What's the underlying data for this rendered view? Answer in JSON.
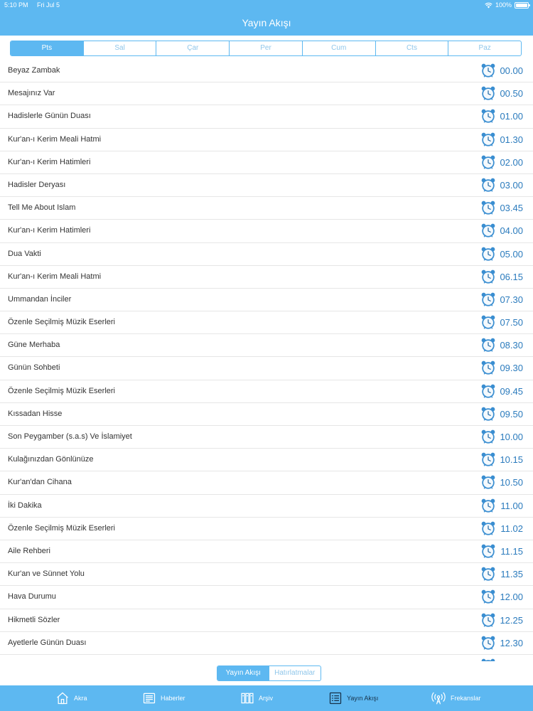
{
  "status_bar": {
    "time": "5:10 PM",
    "date": "Fri Jul 5",
    "battery": "100%",
    "battery_level": 1.0
  },
  "page_title": "Yayın Akışı",
  "day_tabs": [
    "Pts",
    "Sal",
    "Çar",
    "Per",
    "Cum",
    "Cts",
    "Paz"
  ],
  "active_day_index": 0,
  "schedule": [
    {
      "title": "Beyaz Zambak",
      "time": "00.00"
    },
    {
      "title": "Mesajınız Var",
      "time": "00.50"
    },
    {
      "title": "Hadislerle Günün Duası",
      "time": "01.00"
    },
    {
      "title": "Kur'an-ı Kerim Meali Hatmi",
      "time": "01.30"
    },
    {
      "title": "Kur'an-ı Kerim Hatimleri",
      "time": "02.00"
    },
    {
      "title": "Hadisler Deryası",
      "time": "03.00"
    },
    {
      "title": "Tell Me About Islam",
      "time": "03.45"
    },
    {
      "title": "Kur'an-ı Kerim Hatimleri",
      "time": "04.00"
    },
    {
      "title": "Dua Vakti",
      "time": "05.00"
    },
    {
      "title": "Kur'an-ı Kerim Meali Hatmi",
      "time": "06.15"
    },
    {
      "title": "Ummandan İnciler",
      "time": "07.30"
    },
    {
      "title": "Özenle Seçilmiş Müzik Eserleri",
      "time": "07.50"
    },
    {
      "title": "Güne Merhaba",
      "time": "08.30"
    },
    {
      "title": "Günün Sohbeti",
      "time": "09.30"
    },
    {
      "title": "Özenle Seçilmiş Müzik Eserleri",
      "time": "09.45"
    },
    {
      "title": "Kıssadan Hisse",
      "time": "09.50"
    },
    {
      "title": "Son Peygamber (s.a.s) Ve İslamiyet",
      "time": "10.00"
    },
    {
      "title": "Kulağınızdan Gönlünüze",
      "time": "10.15"
    },
    {
      "title": "Kur'an'dan Cihana",
      "time": "10.50"
    },
    {
      "title": "İki Dakika",
      "time": "11.00"
    },
    {
      "title": "Özenle Seçilmiş Müzik Eserleri",
      "time": "11.02"
    },
    {
      "title": "Aile Rehberi",
      "time": "11.15"
    },
    {
      "title": "Kur'an ve Sünnet Yolu",
      "time": "11.35"
    },
    {
      "title": "Hava Durumu",
      "time": "12.00"
    },
    {
      "title": "Hikmetli Sözler",
      "time": "12.25"
    },
    {
      "title": "Ayetlerle Günün Duası",
      "time": "12.30"
    }
  ],
  "bottom_toggle": {
    "left": "Yayın Akışı",
    "right": "Hatırlatmalar"
  },
  "tab_bar": {
    "items": [
      {
        "label": "Akra",
        "icon": "home-icon"
      },
      {
        "label": "Haberler",
        "icon": "newspaper-icon"
      },
      {
        "label": "Arşiv",
        "icon": "archive-icon"
      },
      {
        "label": "Yayın Akışı",
        "icon": "list-icon"
      },
      {
        "label": "Frekanslar",
        "icon": "radio-tower-icon"
      }
    ],
    "active_index": 3
  },
  "colors": {
    "primary": "#5db8f1",
    "time_text": "#2b7bbd",
    "active_tab": "#17324a"
  }
}
